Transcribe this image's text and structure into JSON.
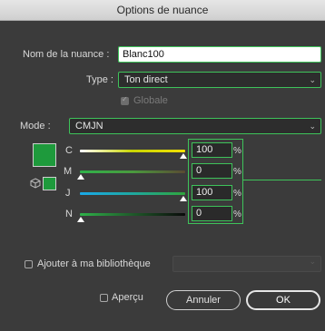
{
  "window": {
    "title": "Options de nuance"
  },
  "name_field": {
    "label": "Nom de la nuance :",
    "value": "Blanc100"
  },
  "type_field": {
    "label": "Type :",
    "value": "Ton direct"
  },
  "globale": {
    "label": "Globale",
    "checked": true
  },
  "mode": {
    "label": "Mode :",
    "value": "CMJN"
  },
  "swatch_color": "#1e9a3c",
  "sliders": [
    {
      "name": "C",
      "value": "100",
      "percent": 100,
      "unit": "%"
    },
    {
      "name": "M",
      "value": "0",
      "percent": 0,
      "unit": "%"
    },
    {
      "name": "J",
      "value": "100",
      "percent": 100,
      "unit": "%"
    },
    {
      "name": "N",
      "value": "0",
      "percent": 0,
      "unit": "%"
    }
  ],
  "library": {
    "label": "Ajouter à ma bibliothèque",
    "checked": false
  },
  "apercu": {
    "label": "Aperçu",
    "checked": false
  },
  "buttons": {
    "cancel": "Annuler",
    "ok": "OK"
  },
  "colors": {
    "accent_border": "#3ec35a",
    "swatch": "#1e9a3c"
  }
}
